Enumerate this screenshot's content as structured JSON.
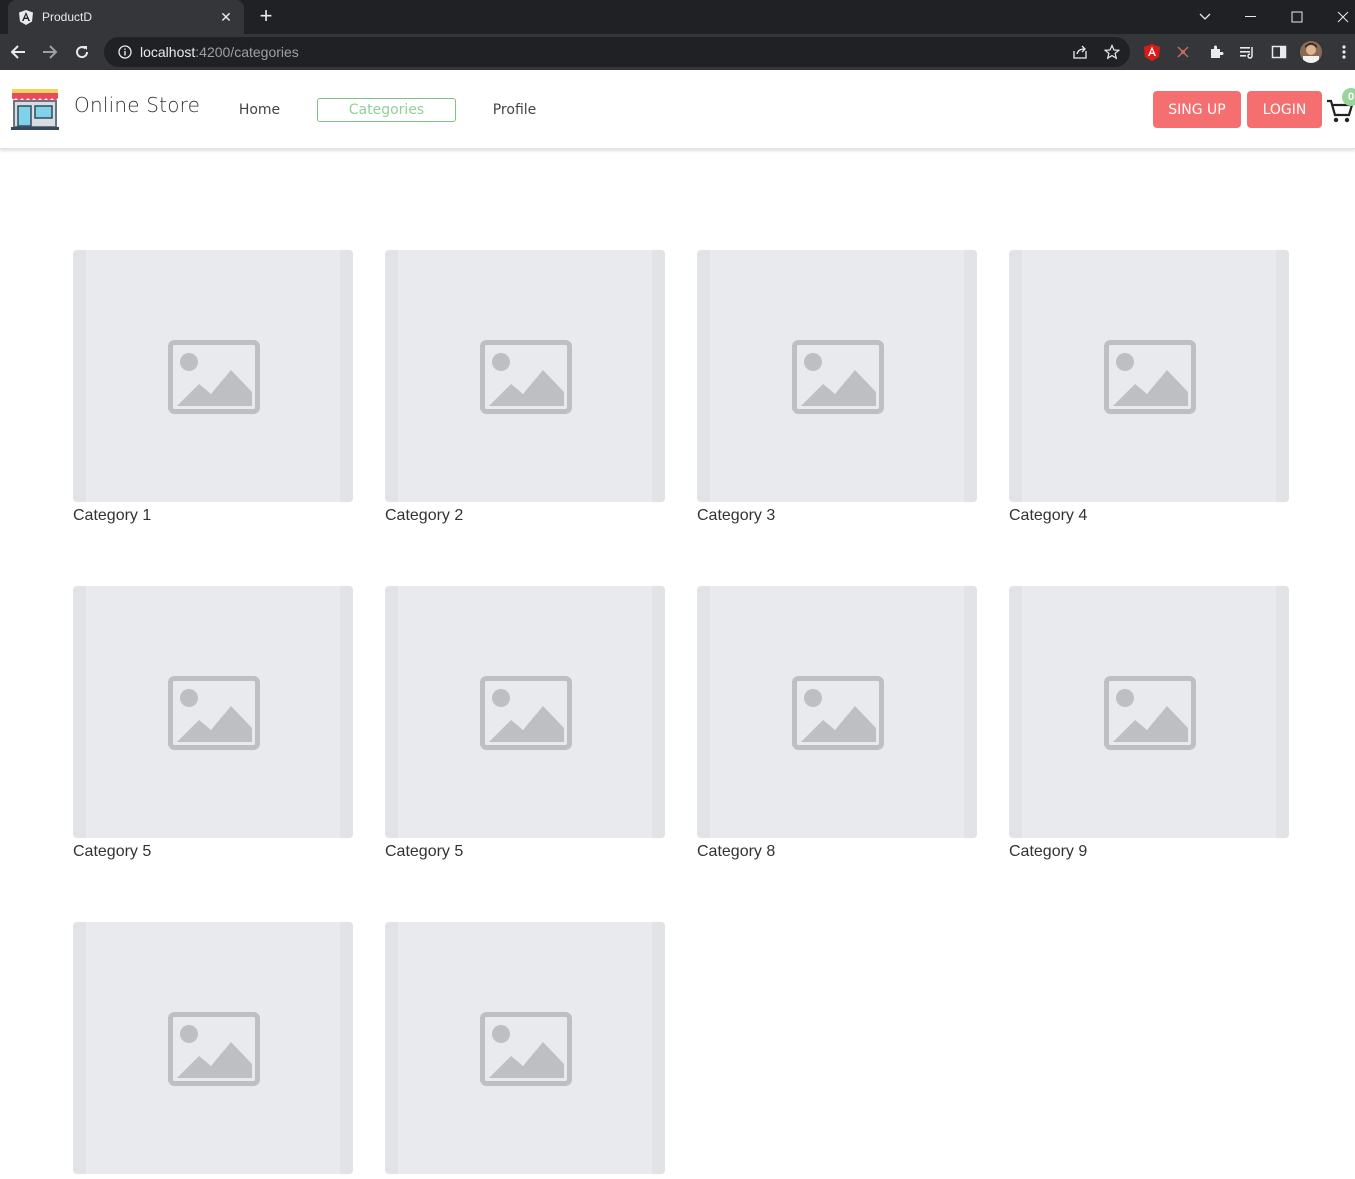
{
  "browser": {
    "tab_title": "ProductD",
    "url_host": "localhost",
    "url_path": ":4200/categories",
    "icons": {
      "favicon": "angular-icon",
      "close": "close-icon",
      "new_tab": "plus-icon",
      "back": "arrow-left-icon",
      "forward": "arrow-right-icon",
      "reload": "reload-icon",
      "info": "info-icon",
      "share": "share-icon",
      "bookmark": "star-icon",
      "extensions": "puzzle-icon",
      "profile": "avatar"
    }
  },
  "header": {
    "brand": "Online Store",
    "nav": [
      {
        "label": "Home"
      },
      {
        "label": "Categories",
        "active": true
      },
      {
        "label": "Profile"
      }
    ],
    "signup_label": "SING UP",
    "login_label": "LOGIN",
    "cart_count": "0",
    "colors": {
      "accent_red": "#f56f70",
      "active_green": "#7dc383",
      "badge_green": "#9bd39d"
    }
  },
  "categories": [
    {
      "label": "Category 1"
    },
    {
      "label": "Category 2"
    },
    {
      "label": "Category 3"
    },
    {
      "label": "Category 4"
    },
    {
      "label": "Category 5"
    },
    {
      "label": "Category 5"
    },
    {
      "label": "Category 8"
    },
    {
      "label": "Category 9"
    },
    {
      "label": ""
    },
    {
      "label": ""
    }
  ]
}
